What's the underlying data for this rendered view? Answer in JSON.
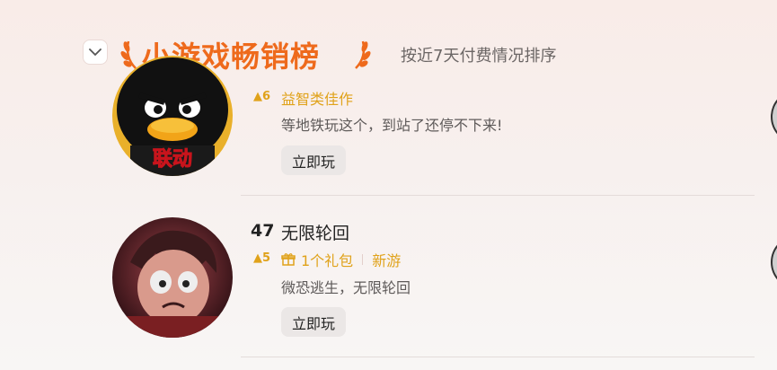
{
  "header": {
    "title": "小游戏畅销榜",
    "subtitle": "按近7天付费情况排序"
  },
  "items": [
    {
      "rank": "",
      "name": "",
      "delta": "▲6",
      "tags": [
        "益智类佳作"
      ],
      "description": "等地铁玩这个，到站了还停不下来!",
      "play_label": "立即玩",
      "avatar_badge": "联动"
    },
    {
      "rank": "47",
      "name": "无限轮回",
      "delta": "▲5",
      "tags": [
        "1个礼包",
        "新游"
      ],
      "description": "微恐逃生，无限轮回",
      "play_label": "立即玩"
    }
  ],
  "colors": {
    "accent": "#ee6a1c",
    "tag": "#e0a21a"
  }
}
